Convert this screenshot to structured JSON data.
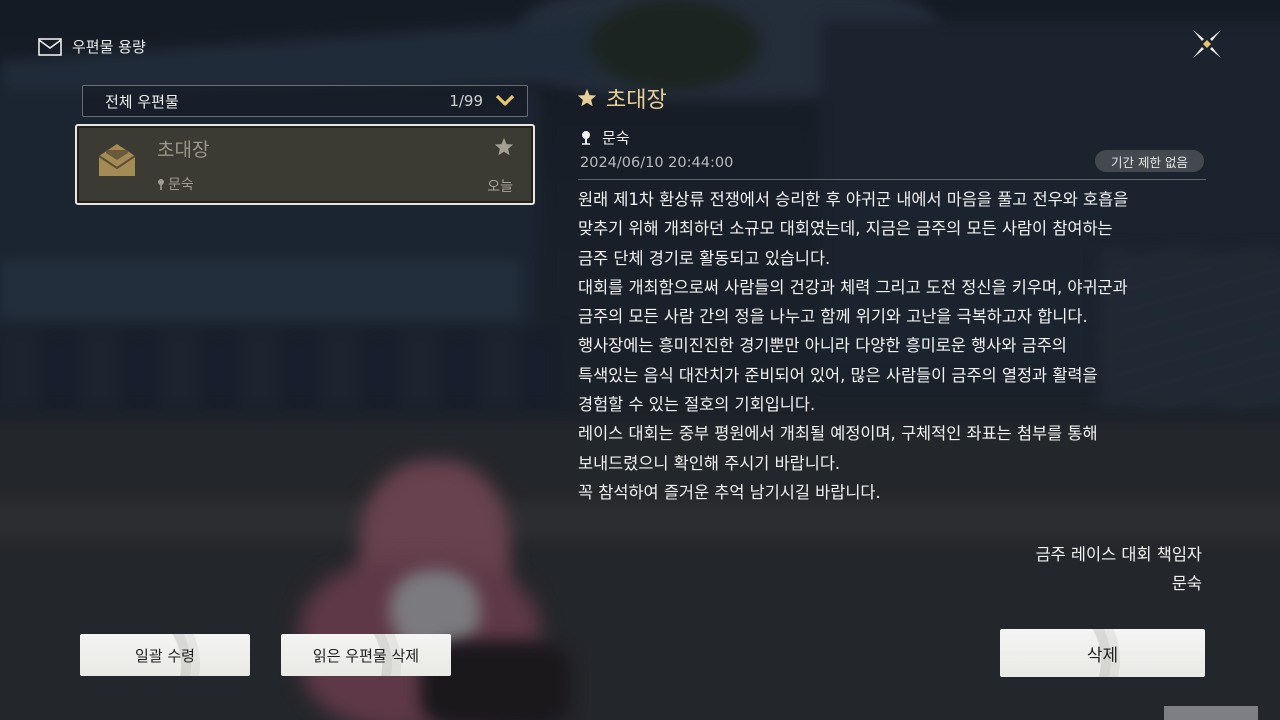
{
  "header": {
    "title": "우편물 용량"
  },
  "filter": {
    "label": "전체 우편물",
    "count": "1/99"
  },
  "mail_list": [
    {
      "title": "초대장",
      "sender": "문숙",
      "date": "오늘",
      "starred": true,
      "selected": true
    }
  ],
  "detail": {
    "title": "초대장",
    "sender": "문숙",
    "timestamp": "2024/06/10 20:44:00",
    "expiry": "기간 제한 없음",
    "body": "원래 제1차 환상류 전쟁에서 승리한 후 야귀군 내에서 마음을 풀고 전우와 호흡을\n맞추기 위해 개최하던 소규모 대회였는데, 지금은 금주의 모든 사람이 참여하는\n금주 단체 경기로 활동되고 있습니다.\n대회를 개최함으로써 사람들의 건강과 체력 그리고 도전 정신을 키우며, 야귀군과\n금주의 모든 사람 간의 정을 나누고 함께 위기와 고난을 극복하고자 합니다.\n행사장에는 흥미진진한 경기뿐만 아니라 다양한 흥미로운 행사와 금주의\n특색있는 음식 대잔치가 준비되어 있어, 많은 사람들이 금주의 열정과 활력을\n경험할 수 있는 절호의 기회입니다.\n레이스 대회는 중부 평원에서 개최될 예정이며, 구체적인 좌표는 첨부를 통해\n보내드렸으니 확인해 주시기 바랍니다.\n꼭 참석하여 즐거운 추억 남기시길 바랍니다.",
    "signature_line1": "금주 레이스 대회 책임자",
    "signature_line2": "문숙"
  },
  "buttons": {
    "claim_all": "일괄 수령",
    "delete_read": "읽은 우편물 삭제",
    "delete": "삭제"
  },
  "icons": {
    "header": "mail-icon",
    "close": "close-x-icon",
    "dropdown": "chevron-down-icon",
    "mail_item": "envelope-icon",
    "favorite": "star-icon",
    "sender": "pin-icon"
  },
  "colors": {
    "accent_gold": "#e7cf96",
    "chevron_gold": "#e8c66a",
    "selected_border": "#e9e6df",
    "item_bg": "#484234"
  }
}
